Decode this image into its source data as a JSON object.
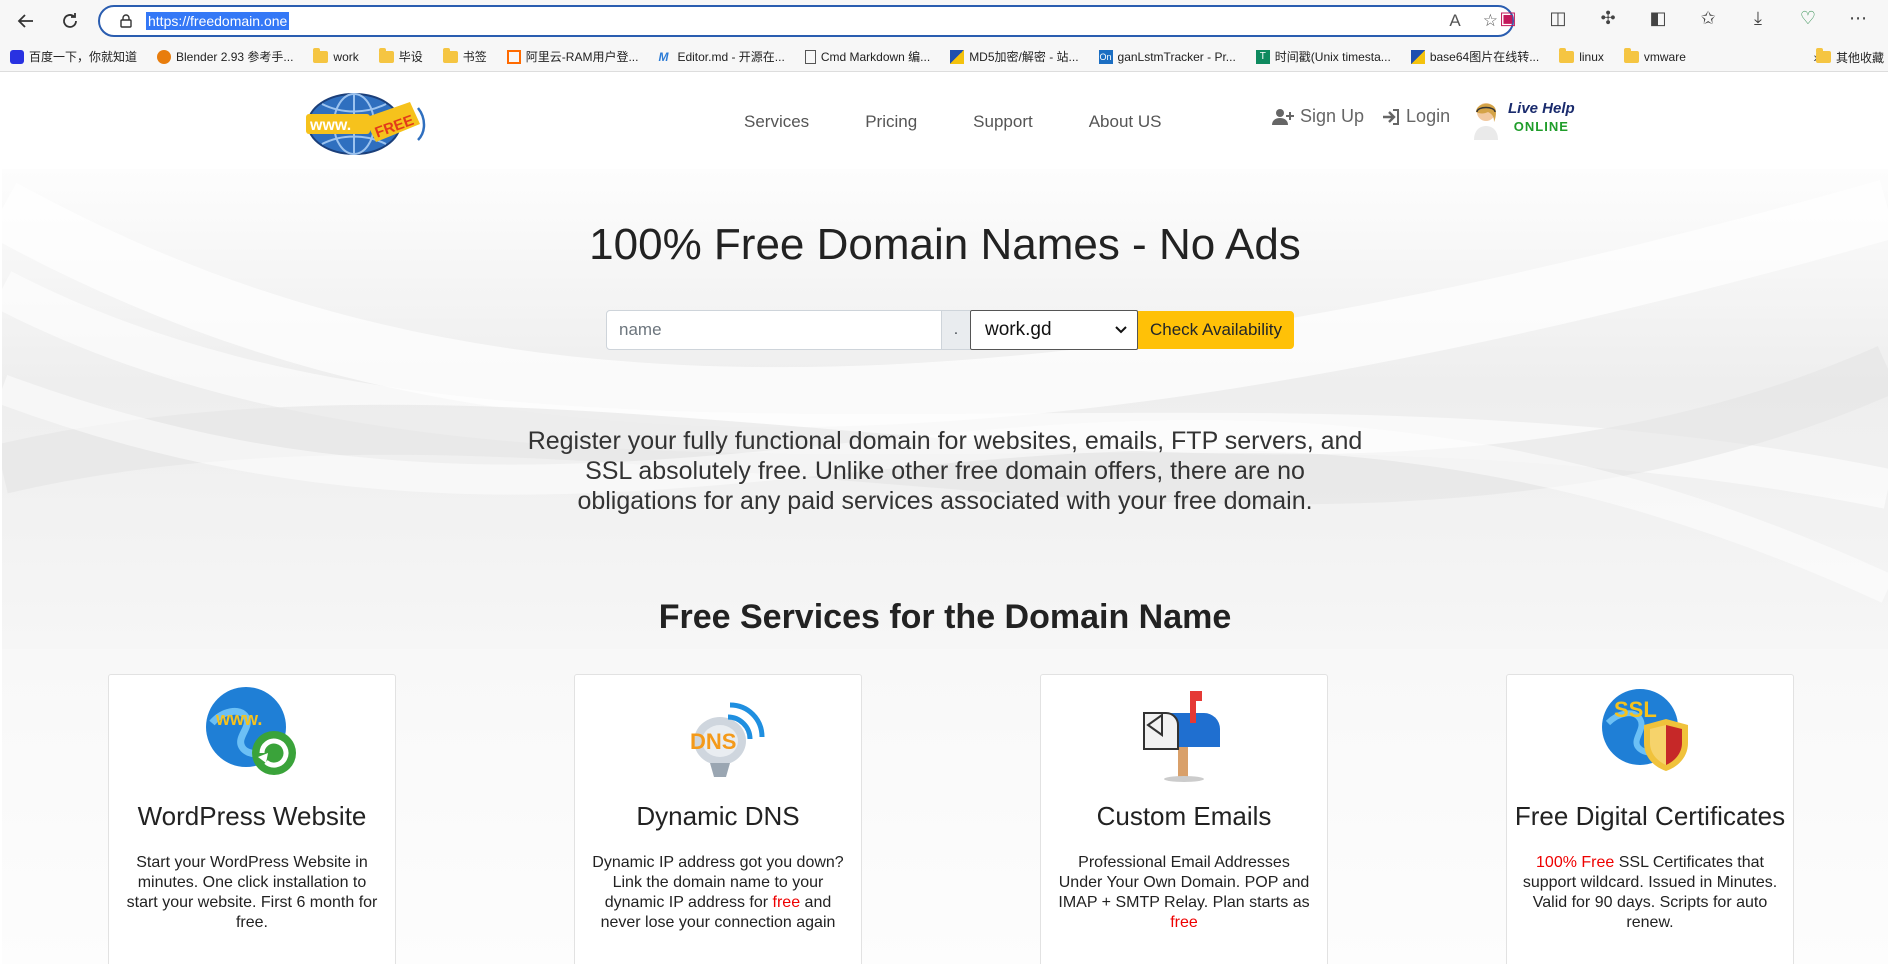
{
  "browser": {
    "url": "https://freedomain.one",
    "bookmarks": [
      {
        "label": "百度一下，你就知道",
        "icon": "baidu-icon"
      },
      {
        "label": "Blender 2.93 参考手...",
        "icon": "blender-icon"
      },
      {
        "label": "work",
        "icon": "folder-icon"
      },
      {
        "label": "毕设",
        "icon": "folder-icon"
      },
      {
        "label": "书签",
        "icon": "folder-icon"
      },
      {
        "label": "阿里云-RAM用户登...",
        "icon": "aliyun-icon"
      },
      {
        "label": "Editor.md - 开源在...",
        "icon": "editormd-icon"
      },
      {
        "label": "Cmd Markdown 编...",
        "icon": "page-icon"
      },
      {
        "label": "MD5加密/解密 - 站...",
        "icon": "md5-icon"
      },
      {
        "label": "ganLstmTracker - Pr...",
        "icon": "on-icon"
      },
      {
        "label": "时间戳(Unix timesta...",
        "icon": "timestamp-icon"
      },
      {
        "label": "base64图片在线转...",
        "icon": "base64-icon"
      },
      {
        "label": "linux",
        "icon": "folder-icon"
      },
      {
        "label": "vmware",
        "icon": "folder-icon"
      }
    ],
    "other_bookmarks": "其他收藏"
  },
  "header": {
    "nav": [
      "Services",
      "Pricing",
      "Support",
      "About US"
    ],
    "signup": "Sign Up",
    "login": "Login",
    "live_help": "Live Help",
    "online": "ONLINE"
  },
  "hero": {
    "title": "100% Free Domain Names - No Ads",
    "search_placeholder": "name",
    "dot": ".",
    "tld_selected": "work.gd",
    "check_button": "Check Availability",
    "description": "Register your fully functional domain for websites, emails, FTP servers, and SSL absolutely free. Unlike other free domain offers, there are no obligations for any paid services associated with your free domain."
  },
  "services": {
    "title": "Free Services for the Domain Name",
    "cards": [
      {
        "title": "WordPress Website",
        "text": "Start your WordPress Website in minutes. One click installation to start your website. First 6 month for free.",
        "icon": "wordpress-globe-icon"
      },
      {
        "title": "Dynamic DNS",
        "text_before": "Dynamic IP address got you down? Link the domain name to your dynamic IP address for ",
        "red": "free",
        "text_after": " and never lose your connection again",
        "icon": "dns-satellite-icon"
      },
      {
        "title": "Custom Emails",
        "text_before": "Professional Email Addresses Under Your Own Domain. POP and IMAP + SMTP Relay. Plan starts as ",
        "red": "free",
        "text_after": "",
        "icon": "mailbox-icon"
      },
      {
        "title": "Free Digital Certificates",
        "red": "100% Free",
        "text_after": " SSL Certificates that support wildcard. Issued in Minutes. Valid for 90 days. Scripts for auto renew.",
        "icon": "ssl-shield-icon"
      }
    ]
  }
}
